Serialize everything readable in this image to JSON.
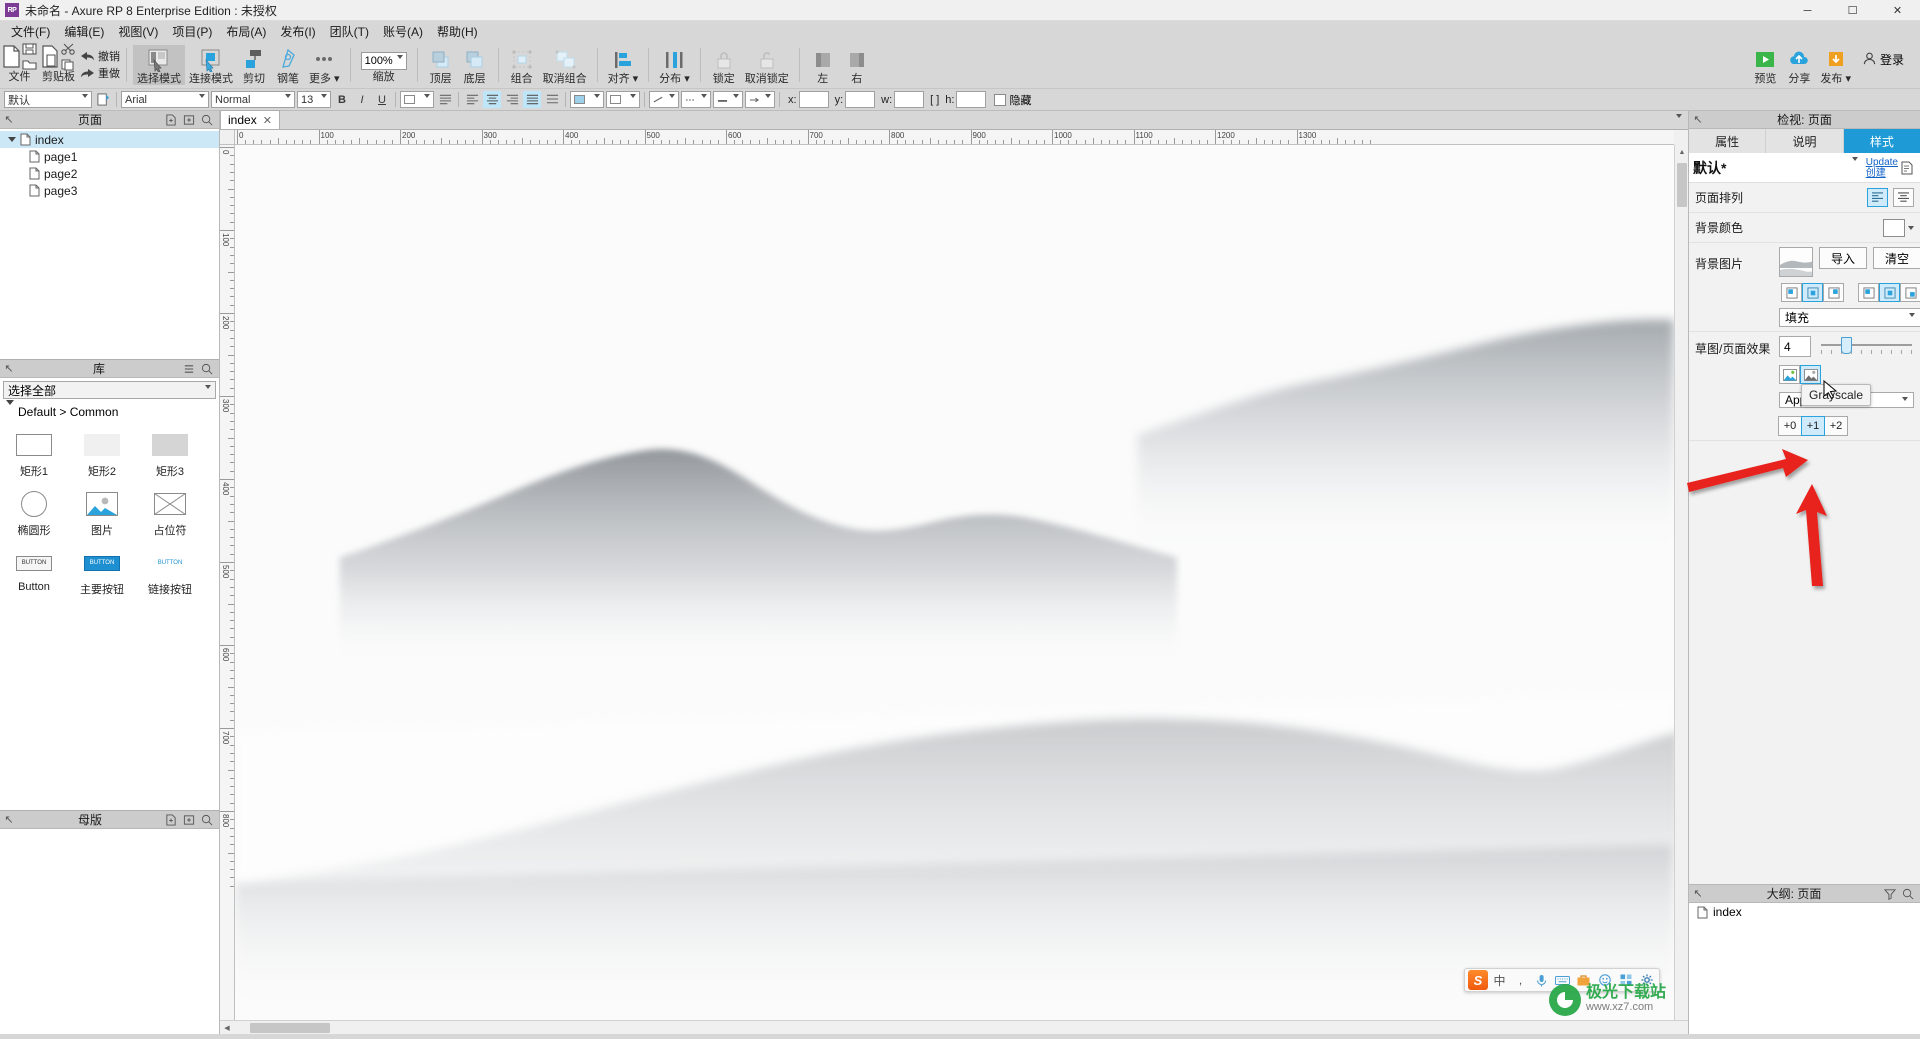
{
  "window": {
    "title": "未命名 - Axure RP 8 Enterprise Edition : 未授权",
    "logo_text": "RP",
    "minimize": "─",
    "maximize": "☐",
    "close": "✕"
  },
  "menubar": {
    "items": [
      {
        "label": "文件(F)",
        "name": "menu-file"
      },
      {
        "label": "编辑(E)",
        "name": "menu-edit"
      },
      {
        "label": "视图(V)",
        "name": "menu-view"
      },
      {
        "label": "项目(P)",
        "name": "menu-project"
      },
      {
        "label": "布局(A)",
        "name": "menu-layout"
      },
      {
        "label": "发布(I)",
        "name": "menu-publish"
      },
      {
        "label": "团队(T)",
        "name": "menu-team"
      },
      {
        "label": "账号(A)",
        "name": "menu-account"
      },
      {
        "label": "帮助(H)",
        "name": "menu-help"
      }
    ]
  },
  "toolbar": {
    "file_label": "文件",
    "clipboard_label": "剪贴板",
    "undo_label": "撤销",
    "redo_label": "重做",
    "select_mode_label": "选择模式",
    "connect_mode_label": "连接模式",
    "crop_label": "剪切",
    "pen_label": "钢笔",
    "more_label": "更多",
    "zoom_value": "100%",
    "zoom_label": "缩放",
    "top_label": "顶层",
    "bottom_label": "底层",
    "group_label": "组合",
    "ungroup_label": "取消组合",
    "align_label": "对齐",
    "distribute_label": "分布",
    "lock_label": "锁定",
    "unlock_label": "取消锁定",
    "left_label": "左",
    "right_label": "右",
    "preview_label": "预览",
    "share_label": "分享",
    "publish_label": "发布",
    "login_label": "登录"
  },
  "formatbar": {
    "style_value": "默认",
    "font_value": "Arial",
    "weight_value": "Normal",
    "size_value": "13",
    "bold": "B",
    "italic": "I",
    "underline": "U",
    "x_label": "x:",
    "y_label": "y:",
    "w_label": "w:",
    "h_label": "h:",
    "x_value": "",
    "y_value": "",
    "w_value": "",
    "h_value": "",
    "hidden_label": "隐藏"
  },
  "pages_panel": {
    "title": "页面",
    "add_page_icon": "add-page-icon",
    "add_folder_icon": "add-folder-icon",
    "search_icon": "search-icon",
    "tree": [
      {
        "label": "index",
        "level": 0,
        "selected": true,
        "expanded": true
      },
      {
        "label": "page1",
        "level": 1,
        "selected": false
      },
      {
        "label": "page2",
        "level": 1,
        "selected": false
      },
      {
        "label": "page3",
        "level": 1,
        "selected": false
      }
    ]
  },
  "library_panel": {
    "title": "库",
    "select_value": "选择全部",
    "group_label": "Default > Common",
    "items": [
      {
        "label": "矩形1",
        "kind": "rect1"
      },
      {
        "label": "矩形2",
        "kind": "rect2"
      },
      {
        "label": "矩形3",
        "kind": "rect3"
      },
      {
        "label": "椭圆形",
        "kind": "ellipse"
      },
      {
        "label": "图片",
        "kind": "image"
      },
      {
        "label": "占位符",
        "kind": "placeholder"
      },
      {
        "label": "Button",
        "kind": "button"
      },
      {
        "label": "主要按钮",
        "kind": "primary-button"
      },
      {
        "label": "链接按钮",
        "kind": "link-button"
      }
    ]
  },
  "masters_panel": {
    "title": "母版"
  },
  "canvas": {
    "tab_label": "index",
    "tab_close": "✕",
    "ruler_h_ticks": [
      "0",
      "100",
      "200",
      "300",
      "400",
      "500",
      "600",
      "700",
      "800",
      "900",
      "1000",
      "1100",
      "1200",
      "1300"
    ],
    "ruler_v_ticks": [
      "0",
      "100",
      "200",
      "300",
      "400",
      "500",
      "600",
      "700",
      "800"
    ]
  },
  "ime": {
    "logo": "S",
    "mode_label": "中",
    "keyboard_icon": "keyboard-icon",
    "mic_icon": "mic-icon",
    "emoji_icon": "emoji-icon",
    "toolbox_icon": "toolbox-icon",
    "apps_icon": "apps-icon",
    "settings_icon": "gear-icon"
  },
  "watermark": {
    "brand": "极光下载站",
    "url": "www.xz7.com"
  },
  "inspector": {
    "header_title": "检视: 页面",
    "tabs": [
      {
        "label": "属性",
        "active": false
      },
      {
        "label": "说明",
        "active": false
      },
      {
        "label": "样式",
        "active": true
      }
    ],
    "style_name": "默认*",
    "update_link": "Update",
    "create_link": "创建",
    "rows": {
      "page_align_label": "页面排列",
      "bg_color_label": "背景颜色",
      "bg_image_label": "背景图片",
      "import_btn": "导入",
      "clear_btn": "清空",
      "repeat_value": "填充",
      "sketch_label": "草图/页面效果",
      "sketch_value": "4",
      "color_effect_value": "Applied",
      "offset_options": [
        "+0",
        "+1",
        "+2"
      ],
      "offset_selected": "+1"
    },
    "tooltip": "Grayscale"
  },
  "outline_panel": {
    "title": "大纲: 页面",
    "items": [
      {
        "label": "index"
      }
    ]
  },
  "colors": {
    "accent": "#1e9bd7",
    "accent_light": "#cfeafb",
    "arrow_red": "#e8201b",
    "chrome": "#d7d7d7",
    "link": "#1464c8"
  }
}
